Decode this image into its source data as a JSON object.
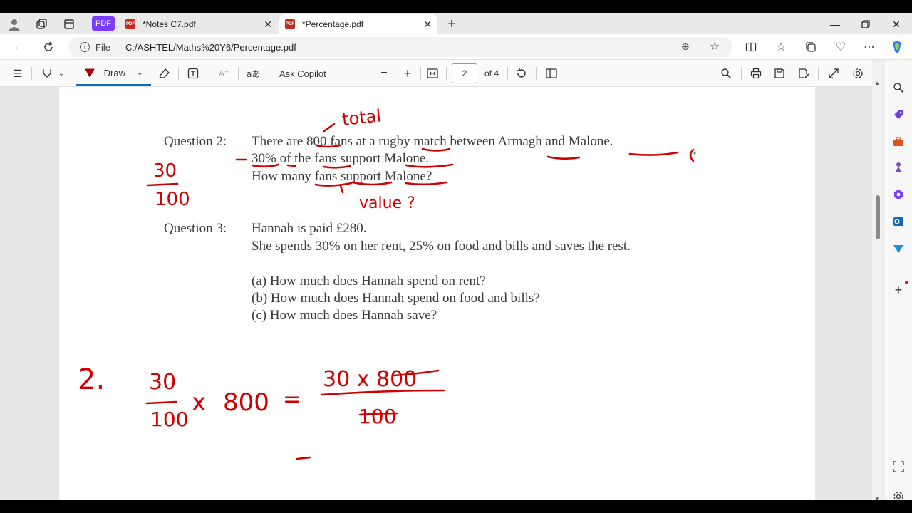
{
  "tabs": [
    {
      "title": "*Notes C7.pdf",
      "active": false
    },
    {
      "title": "*Percentage.pdf",
      "active": true
    }
  ],
  "pdf_badge": "PDF",
  "address": {
    "scheme_label": "File",
    "url": "C:/ASHTEL/Maths%20Y6/Percentage.pdf"
  },
  "toolbar": {
    "draw_label": "Draw",
    "ask_copilot_label": "Ask Copilot",
    "page_current": "2",
    "page_total": "of 4"
  },
  "document": {
    "q2_label": "Question 2:",
    "q2_line1": "There are 800 fans at a rugby match between Armagh and Malone.",
    "q2_line2": "30% of the fans support Malone.",
    "q2_line3": "How many fans support Malone?",
    "q3_label": "Question 3:",
    "q3_line1": "Hannah is paid £280.",
    "q3_line2": "She spends 30% on her rent, 25% on food and bills and saves the rest.",
    "q3_a": "(a) How much does Hannah spend on rent?",
    "q3_b": "(b) How much does Hannah spend on food and bills?",
    "q3_c": "(c) How much does Hannah save?"
  },
  "annotations": {
    "total": "total",
    "value": "value ?",
    "frac_num": "30",
    "frac_den": "100",
    "work_label": "2.",
    "work_num": "30",
    "work_den": "100",
    "work_times": "x",
    "work_800": "800",
    "work_eq": "=",
    "work_rhs_num": "30  x 800",
    "work_rhs_den": "100"
  },
  "colors": {
    "ink": "#d00000",
    "accent": "#0f6cbd"
  }
}
